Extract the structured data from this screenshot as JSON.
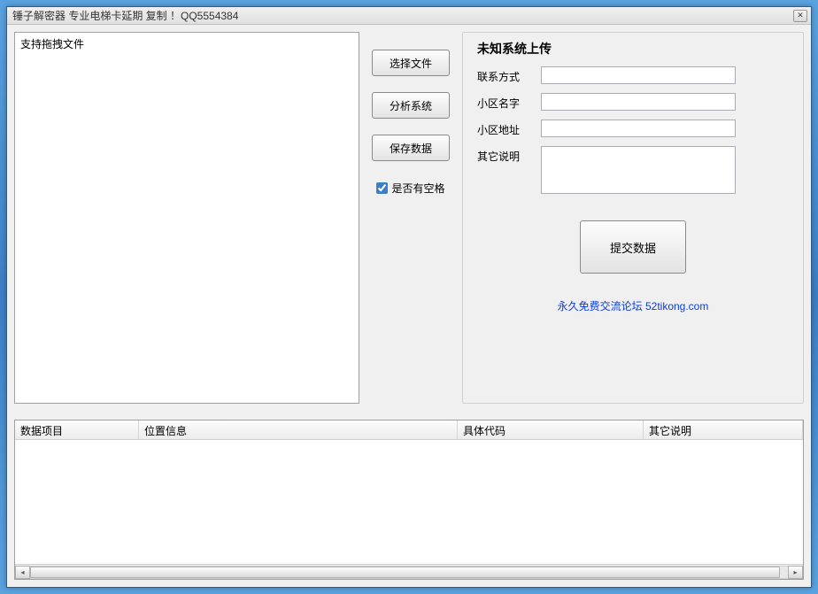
{
  "window": {
    "title": "锤子解密器 专业电梯卡延期 复制 ！QQ5554384"
  },
  "dropArea": {
    "placeholder": "支持拖拽文件"
  },
  "buttons": {
    "chooseFile": "选择文件",
    "analyzeSystem": "分析系统",
    "saveData": "保存数据",
    "checkboxLabel": "是否有空格",
    "submit": "提交数据"
  },
  "uploadGroup": {
    "legend": "未知系统上传",
    "contactLabel": "联系方式",
    "communityNameLabel": "小区名字",
    "communityAddrLabel": "小区地址",
    "otherLabel": "其它说明",
    "contactValue": "",
    "communityNameValue": "",
    "communityAddrValue": "",
    "otherValue": ""
  },
  "link": "永久免费交流论坛 52tikong.com",
  "table": {
    "columns": [
      "数据项目",
      "位置信息",
      "具体代码",
      "其它说明"
    ]
  }
}
